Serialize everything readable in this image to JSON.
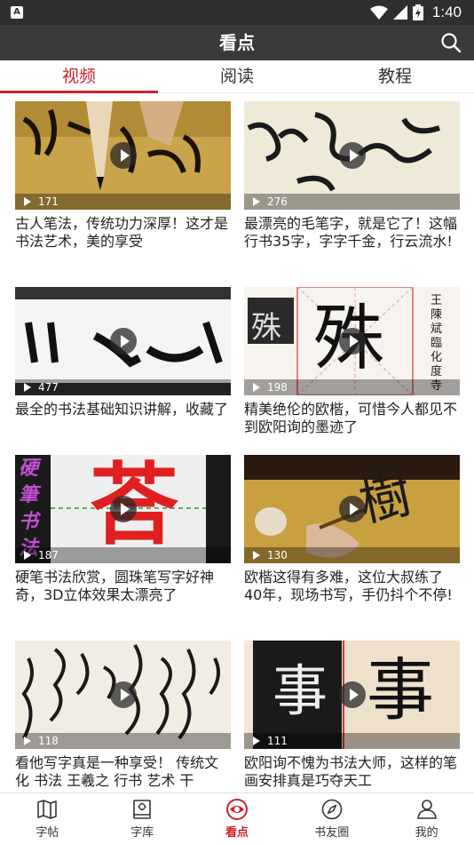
{
  "status_bar": {
    "time": "1:40"
  },
  "app_bar": {
    "title": "看点"
  },
  "tabs": [
    {
      "label": "视频",
      "active": true
    },
    {
      "label": "阅读",
      "active": false
    },
    {
      "label": "教程",
      "active": false
    }
  ],
  "videos": [
    {
      "views": "171",
      "title": "古人笔法，传统功力深厚！这才是书法艺术，美的享受"
    },
    {
      "views": "276",
      "title": "最漂亮的毛笔字，就是它了！这幅行书35字，字字千金，行云流水!"
    },
    {
      "views": "477",
      "title": "最全的书法基础知识讲解，收藏了"
    },
    {
      "views": "198",
      "title": "精美绝伦的欧楷，可惜今人都见不到欧阳询的墨迹了"
    },
    {
      "views": "187",
      "title": "硬笔书法欣赏，圆珠笔写字好神奇，3D立体效果太漂亮了"
    },
    {
      "views": "130",
      "title": "欧楷这得有多难，这位大叔练了40年，现场书写，手仍抖个不停!"
    },
    {
      "views": "118",
      "title": "看他写字真是一种享受！ 传统文化 书法 王羲之 行书 艺术 干"
    },
    {
      "views": "111",
      "title": "欧阳询不愧为书法大师，这样的笔画安排真是巧夺天工"
    }
  ],
  "thumb_text": {
    "v4_small": "王陳斌臨化度寺",
    "v4_big": "殊",
    "v5_side": "硬筆书法",
    "v5_big": "荅",
    "v6_big": "樹",
    "v8_left": "事",
    "v8_right": "事"
  },
  "bottom_nav": [
    {
      "label": "字帖",
      "icon": "map-icon",
      "active": false
    },
    {
      "label": "字库",
      "icon": "book-icon",
      "active": false
    },
    {
      "label": "看点",
      "icon": "eye-icon",
      "active": true
    },
    {
      "label": "书友圈",
      "icon": "compass-icon",
      "active": false
    },
    {
      "label": "我的",
      "icon": "person-icon",
      "active": false
    }
  ],
  "colors": {
    "accent": "#d0202a",
    "appbar": "#3a3a3a",
    "statusbar": "#2f2f2f"
  }
}
